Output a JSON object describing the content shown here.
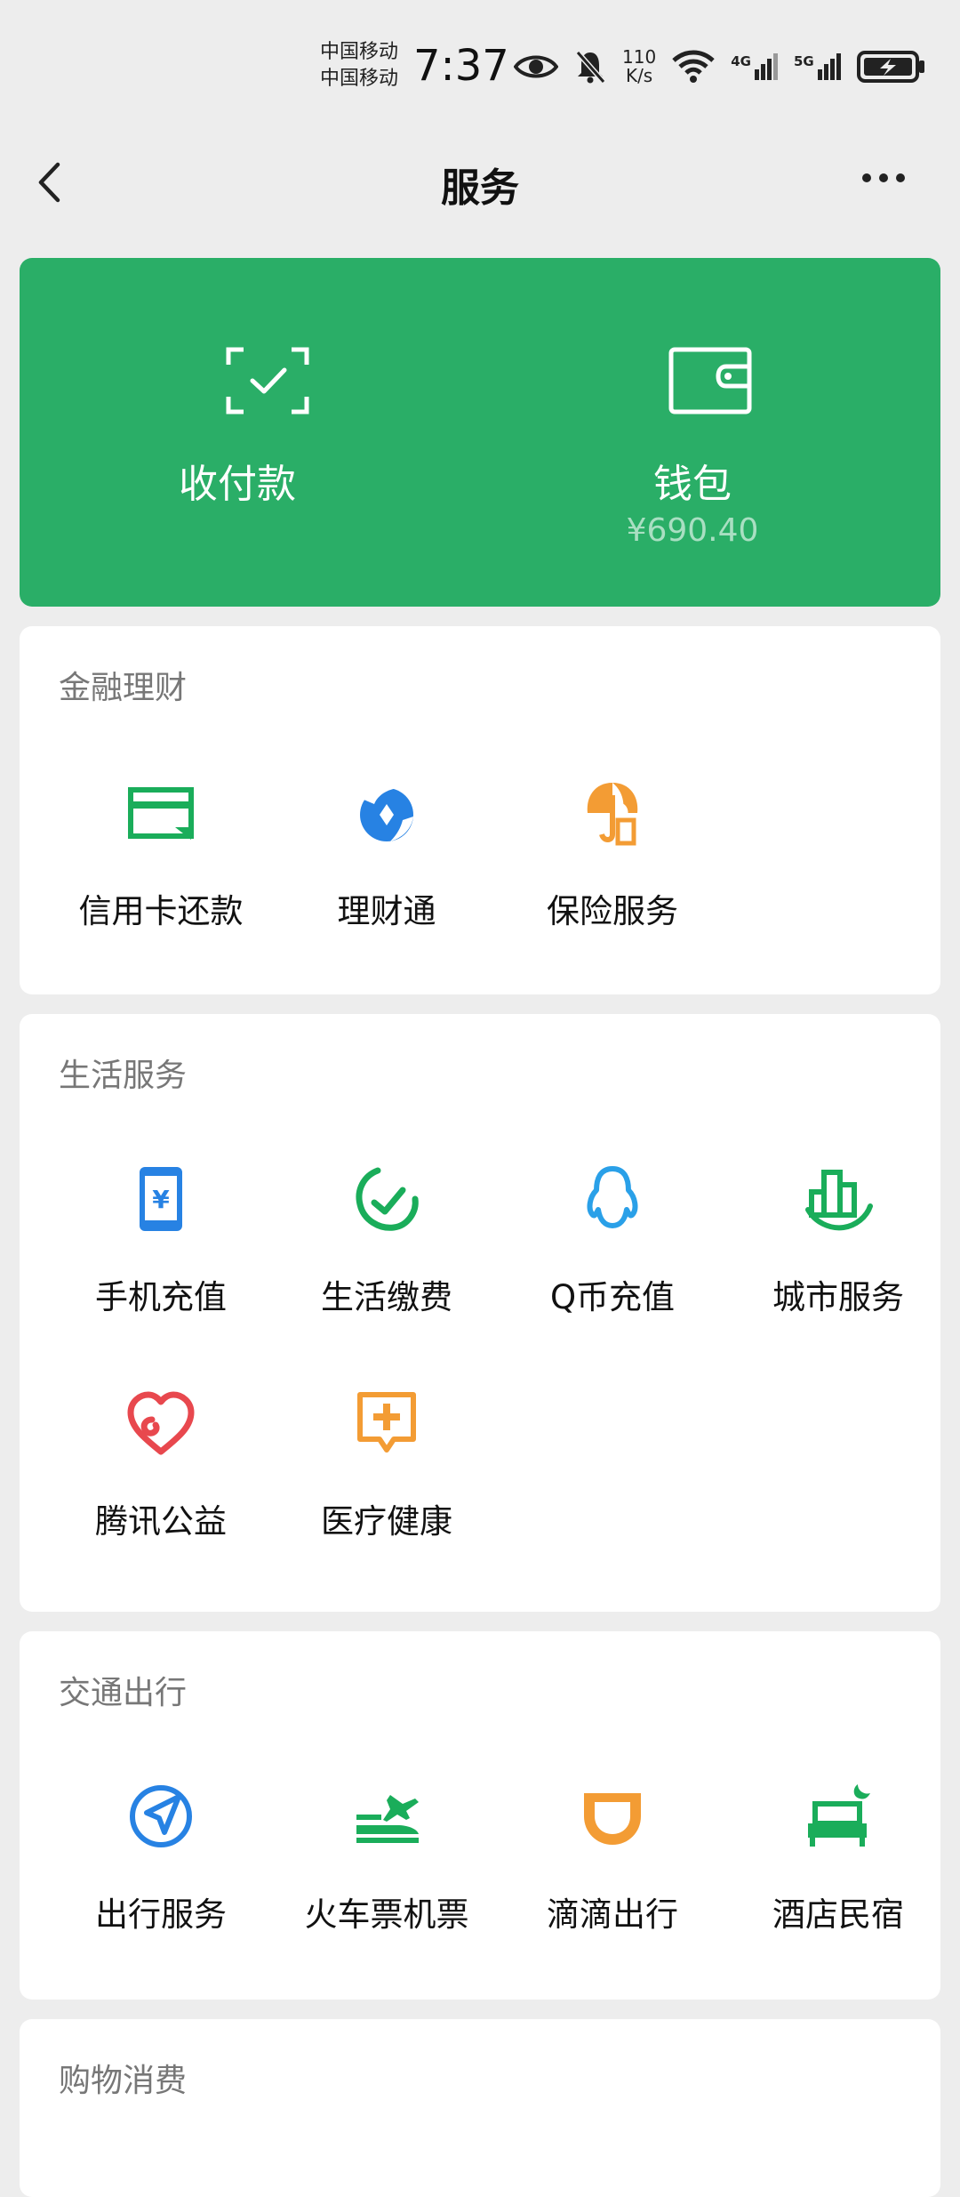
{
  "status_bar": {
    "carrier_1": "中国移动",
    "carrier_2": "中国移动",
    "time": "7:37",
    "speed_value": "110",
    "speed_unit": "K/s",
    "net_1": "4G",
    "net_2": "5G"
  },
  "nav": {
    "title": "服务"
  },
  "pay_card": {
    "pay_label": "收付款",
    "wallet_label": "钱包",
    "wallet_balance": "¥690.40"
  },
  "sections": {
    "finance": {
      "title": "金融理财",
      "items": [
        "信用卡还款",
        "理财通",
        "保险服务"
      ]
    },
    "life": {
      "title": "生活服务",
      "items": [
        "手机充值",
        "生活缴费",
        "Q币充值",
        "城市服务",
        "腾讯公益",
        "医疗健康"
      ]
    },
    "transport": {
      "title": "交通出行",
      "items": [
        "出行服务",
        "火车票机票",
        "滴滴出行",
        "酒店民宿"
      ]
    },
    "shopping": {
      "title": "购物消费"
    }
  },
  "colors": {
    "green_card": "#2aae67",
    "icon_green": "#1aad5a",
    "icon_blue": "#2782e3",
    "icon_orange": "#f39c34",
    "icon_red": "#e8484e",
    "background": "#ededed"
  }
}
